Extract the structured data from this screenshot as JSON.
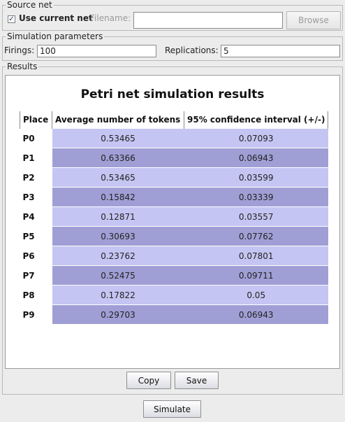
{
  "source_net": {
    "legend": "Source net",
    "use_current_label": "Use current net",
    "use_current_checked": "✓",
    "filename_label": "Filename:",
    "filename_value": "",
    "browse_label": "Browse"
  },
  "sim_params": {
    "legend": "Simulation parameters",
    "firings_label": "Firings:",
    "firings_value": "100",
    "replications_label": "Replications:",
    "replications_value": "5"
  },
  "results": {
    "legend": "Results",
    "title": "Petri net simulation results",
    "columns": [
      "Place",
      "Average number of tokens",
      "95% confidence interval (+/-)"
    ],
    "rows": [
      {
        "place": "P0",
        "avg": "0.53465",
        "ci": "0.07093"
      },
      {
        "place": "P1",
        "avg": "0.63366",
        "ci": "0.06943"
      },
      {
        "place": "P2",
        "avg": "0.53465",
        "ci": "0.03599"
      },
      {
        "place": "P3",
        "avg": "0.15842",
        "ci": "0.03339"
      },
      {
        "place": "P4",
        "avg": "0.12871",
        "ci": "0.03557"
      },
      {
        "place": "P5",
        "avg": "0.30693",
        "ci": "0.07762"
      },
      {
        "place": "P6",
        "avg": "0.23762",
        "ci": "0.07801"
      },
      {
        "place": "P7",
        "avg": "0.52475",
        "ci": "0.09711"
      },
      {
        "place": "P8",
        "avg": "0.17822",
        "ci": "0.05"
      },
      {
        "place": "P9",
        "avg": "0.29703",
        "ci": "0.06943"
      }
    ],
    "copy_label": "Copy",
    "save_label": "Save"
  },
  "simulate_label": "Simulate",
  "colors": {
    "row_light": "#c5c5f3",
    "row_dark": "#9f9fd6"
  }
}
